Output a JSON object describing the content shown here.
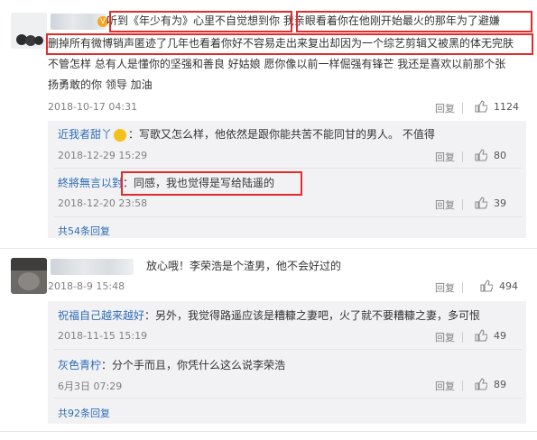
{
  "comment1": {
    "body_lines": [
      "  听到《年少有为》心里不自觉想到你  我亲眼看着你在他刚开始最火的那年为了避嫌",
      "删掉所有微博销声匿迹了几年也看着你好不容易走出来复出却因为一个综艺剪辑又被黑的体无完肤",
      "不管怎样 总有人是懂你的坚强和善良 好姑娘 愿你像以前一样倔强有锋芒 我还是喜欢以前那个张",
      "扬勇敢的你 领导 加油"
    ],
    "time": "2018-10-17 04:31",
    "reply_label": "回复",
    "likes": "1124",
    "replies": [
      {
        "user": "近我者甜丫",
        "sep": "：",
        "text": "写歌又怎么样，他依然是跟你能共苦不能同甘的男人。 不值得",
        "time": "2018-12-29 15:29",
        "reply_label": "回复",
        "likes": "80"
      },
      {
        "user": "終將無言以對",
        "sep": "：",
        "text": "同感，我也觉得是写给陆遥的",
        "time": "2018-12-20 23:58",
        "reply_label": "回复",
        "likes": "39"
      }
    ],
    "more_label": "共54条回复"
  },
  "comment2": {
    "body": "放心哦！李荣浩是个渣男，他不会好过的",
    "time": "2018-8-9 15:48",
    "reply_label": "回复",
    "likes": "494",
    "replies": [
      {
        "user": "祝福自己越来越好",
        "sep": "：",
        "text": "另外，我觉得路遥应该是糟糠之妻吧，火了就不要糟糠之妻，多可恨",
        "time": "2018-11-15 15:19",
        "reply_label": "回复",
        "likes": "49"
      },
      {
        "user": "灰色青柠",
        "sep": "：",
        "text": "分个手而且，你凭什么这么说李荣浩",
        "time": "6月3日 07:29",
        "reply_label": "回复",
        "likes": "89"
      }
    ],
    "more_label": "共92条回复"
  },
  "colors": {
    "link": "#2f6db3",
    "highlight": "#e22c2c",
    "sub_bg": "#f2f2f5"
  }
}
